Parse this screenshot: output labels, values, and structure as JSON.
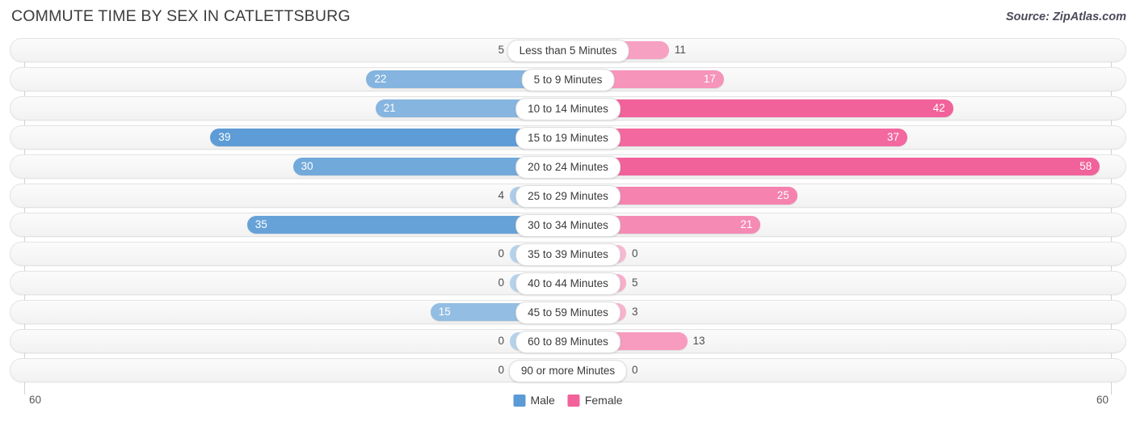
{
  "header": {
    "title": "COMMUTE TIME BY SEX IN CATLETTSBURG",
    "source": "Source: ZipAtlas.com"
  },
  "legend": {
    "male_label": "Male",
    "female_label": "Female",
    "male_color": "#5B9BD5",
    "female_color": "#F2629A"
  },
  "axis": {
    "left_label": "60",
    "right_label": "60",
    "max": 60
  },
  "chart_data": {
    "type": "bar",
    "orientation": "horizontal-diverging",
    "title": "COMMUTE TIME BY SEX IN CATLETTSBURG",
    "xlabel": "",
    "ylabel": "",
    "xlim": [
      60,
      60
    ],
    "grid": false,
    "legend_position": "bottom-center",
    "categories": [
      "Less than 5 Minutes",
      "5 to 9 Minutes",
      "10 to 14 Minutes",
      "15 to 19 Minutes",
      "20 to 24 Minutes",
      "25 to 29 Minutes",
      "30 to 34 Minutes",
      "35 to 39 Minutes",
      "40 to 44 Minutes",
      "45 to 59 Minutes",
      "60 to 89 Minutes",
      "90 or more Minutes"
    ],
    "series": [
      {
        "name": "Male",
        "color": "#5B9BD5",
        "values": [
          5,
          22,
          21,
          39,
          30,
          4,
          35,
          0,
          0,
          15,
          0,
          0
        ]
      },
      {
        "name": "Female",
        "color": "#F2629A",
        "values": [
          11,
          17,
          42,
          37,
          58,
          25,
          21,
          0,
          5,
          3,
          13,
          0
        ]
      }
    ]
  }
}
